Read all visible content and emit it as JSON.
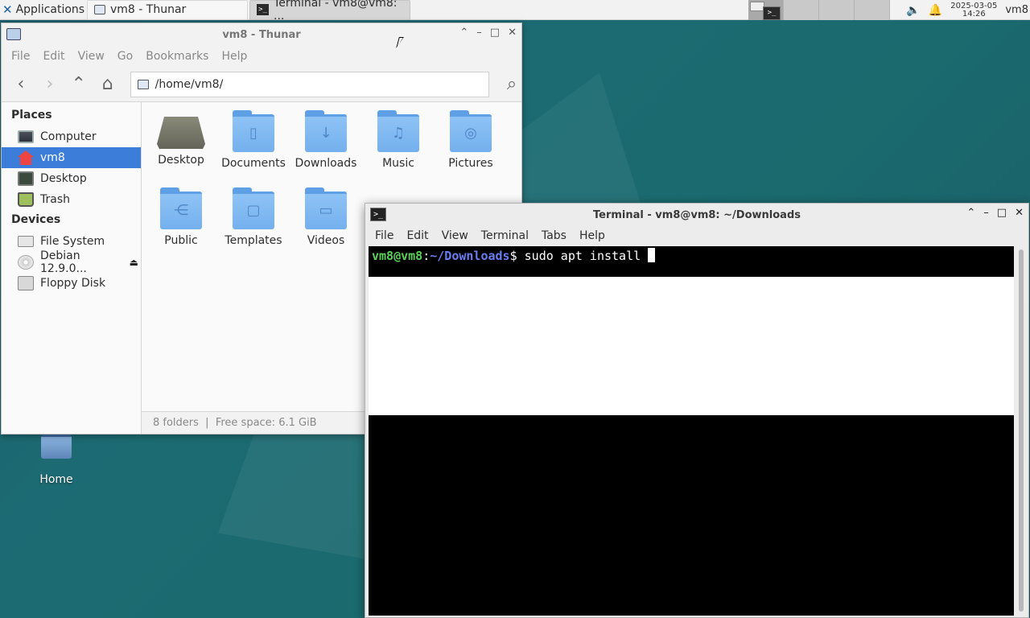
{
  "panel": {
    "applications_label": "Applications",
    "task1": "vm8 - Thunar",
    "task2": "Terminal - vm8@vm8: ...",
    "clock_date": "2025-03-05",
    "clock_time": "14:26",
    "user": "vm8"
  },
  "thunar": {
    "title": "vm8 - Thunar",
    "menu": [
      "File",
      "Edit",
      "View",
      "Go",
      "Bookmarks",
      "Help"
    ],
    "location": "/home/vm8/",
    "sidebar": {
      "places_heading": "Places",
      "places": [
        "Computer",
        "vm8",
        "Desktop",
        "Trash"
      ],
      "devices_heading": "Devices",
      "devices": [
        "File System",
        "Debian 12.9.0...",
        "Floppy Disk"
      ]
    },
    "items": [
      "Desktop",
      "Documents",
      "Downloads",
      "Music",
      "Pictures",
      "Public",
      "Templates",
      "Videos"
    ],
    "status": "8 folders  |  Free space: 6.1 GiB"
  },
  "desktop": {
    "home_label": "Home"
  },
  "terminal": {
    "title": "Terminal - vm8@vm8: ~/Downloads",
    "menu": [
      "File",
      "Edit",
      "View",
      "Terminal",
      "Tabs",
      "Help"
    ],
    "prompt_user": "vm8@vm8",
    "prompt_sep": ":",
    "prompt_path": "~/Downloads",
    "prompt_dollar": "$ ",
    "command": "sudo apt install "
  },
  "icons": {
    "panel": [
      "xfce-logo-icon",
      "volume-icon",
      "bell-icon"
    ],
    "folder_symbols": [
      "document",
      "download-arrow",
      "music-note",
      "camera",
      "share",
      "template",
      "video"
    ]
  }
}
